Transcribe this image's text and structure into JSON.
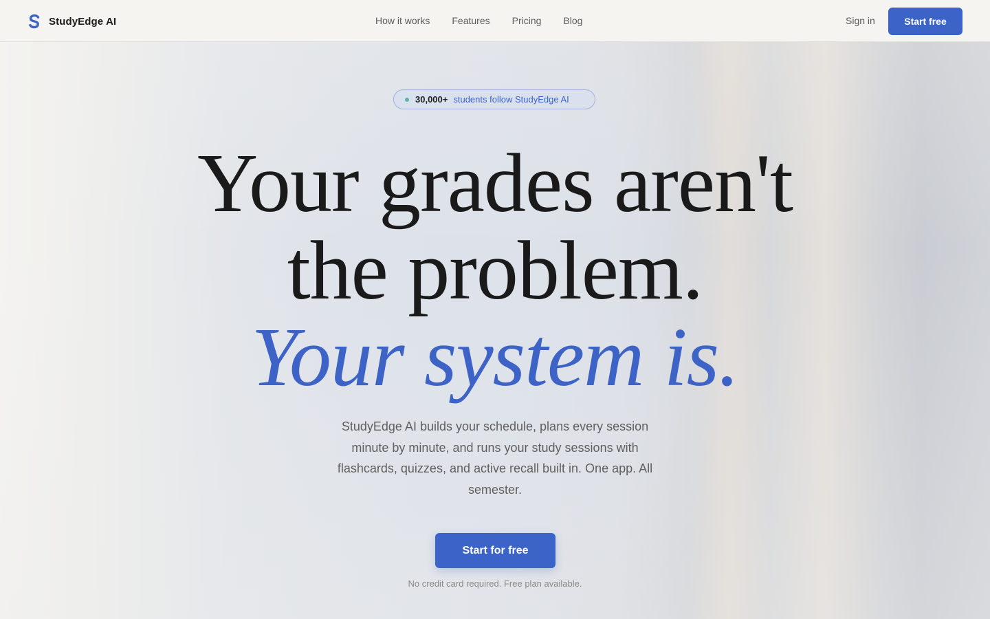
{
  "brand": {
    "name": "StudyEdge AI",
    "icon": "s-logo-icon",
    "accent_color": "#3c64c8"
  },
  "nav": {
    "items": [
      {
        "label": "How it works"
      },
      {
        "label": "Features"
      },
      {
        "label": "Pricing"
      },
      {
        "label": "Blog"
      }
    ],
    "sign_in": "Sign in",
    "start_free": "Start free"
  },
  "hero": {
    "badge": {
      "count": "30,000+",
      "text": "students follow StudyEdge AI",
      "dot_color": "#5fb3a1"
    },
    "headline_line1": "Your grades aren't",
    "headline_line2": "the problem.",
    "headline_line3": "Your system is.",
    "subtext": "StudyEdge AI builds your schedule, plans every session minute by minute, and runs your study sessions with flashcards, quizzes, and active recall built in. One app. All semester.",
    "cta_label": "Start for free",
    "note": "No credit card required. Free plan available."
  }
}
